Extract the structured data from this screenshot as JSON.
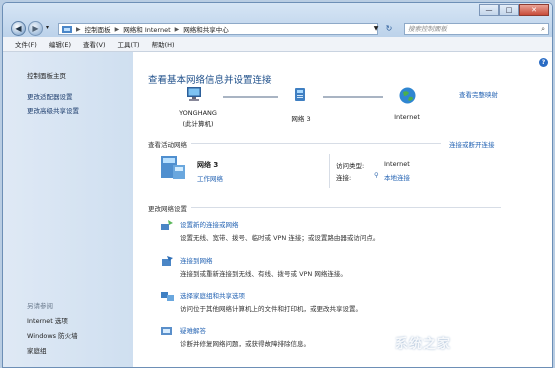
{
  "address": {
    "crumbs": [
      "控制面板",
      "网络和 Internet",
      "网络和共享中心"
    ]
  },
  "search": {
    "placeholder": "搜索控制面板"
  },
  "window_buttons": {
    "minimize": "—",
    "maximize": "□",
    "close": "✕"
  },
  "menu": [
    "文件(F)",
    "编辑(E)",
    "查看(V)",
    "工具(T)",
    "帮助(H)"
  ],
  "sidebar": {
    "items": [
      "控制面板主页",
      "更改适配器设置",
      "更改高级共享设置"
    ],
    "see_also_label": "另请参阅",
    "see_also": [
      "Internet 选项",
      "Windows 防火墙",
      "家庭组"
    ]
  },
  "main": {
    "help": "?",
    "heading": "查看基本网络信息并设置连接",
    "full_map_link": "查看完整映射",
    "nodes": {
      "computer_name": "YONGHANG",
      "computer_sub": "(此计算机)",
      "network": "网络  3",
      "internet": "Internet"
    },
    "active": {
      "title": "查看活动网络",
      "connect_link": "连接或断开连接",
      "network_name": "网络  3",
      "network_type": "工作网络",
      "access_type_label": "访问类型:",
      "access_type_value": "Internet",
      "connections_label": "连接:",
      "connections_value": "本地连接"
    },
    "settings": {
      "title": "更改网络设置",
      "tasks": [
        {
          "title": "设置新的连接或网络",
          "desc": "设置无线、宽带、拨号、临时或 VPN 连接；或设置路由器或访问点。"
        },
        {
          "title": "连接到网络",
          "desc": "连接到或重新连接到无线、有线、拨号或 VPN 网络连接。"
        },
        {
          "title": "选择家庭组和共享选项",
          "desc": "访问位于其他网络计算机上的文件和打印机，或更改共享设置。"
        },
        {
          "title": "疑难解答",
          "desc": "诊断并修复网络问题，或获得故障排除信息。"
        }
      ]
    }
  },
  "watermark": "系统之家",
  "colors": {
    "link": "#2463b3",
    "heading": "#1e4f8a",
    "sidebar_bg": "#dfe9f5",
    "titlebar": "#c8daee"
  }
}
